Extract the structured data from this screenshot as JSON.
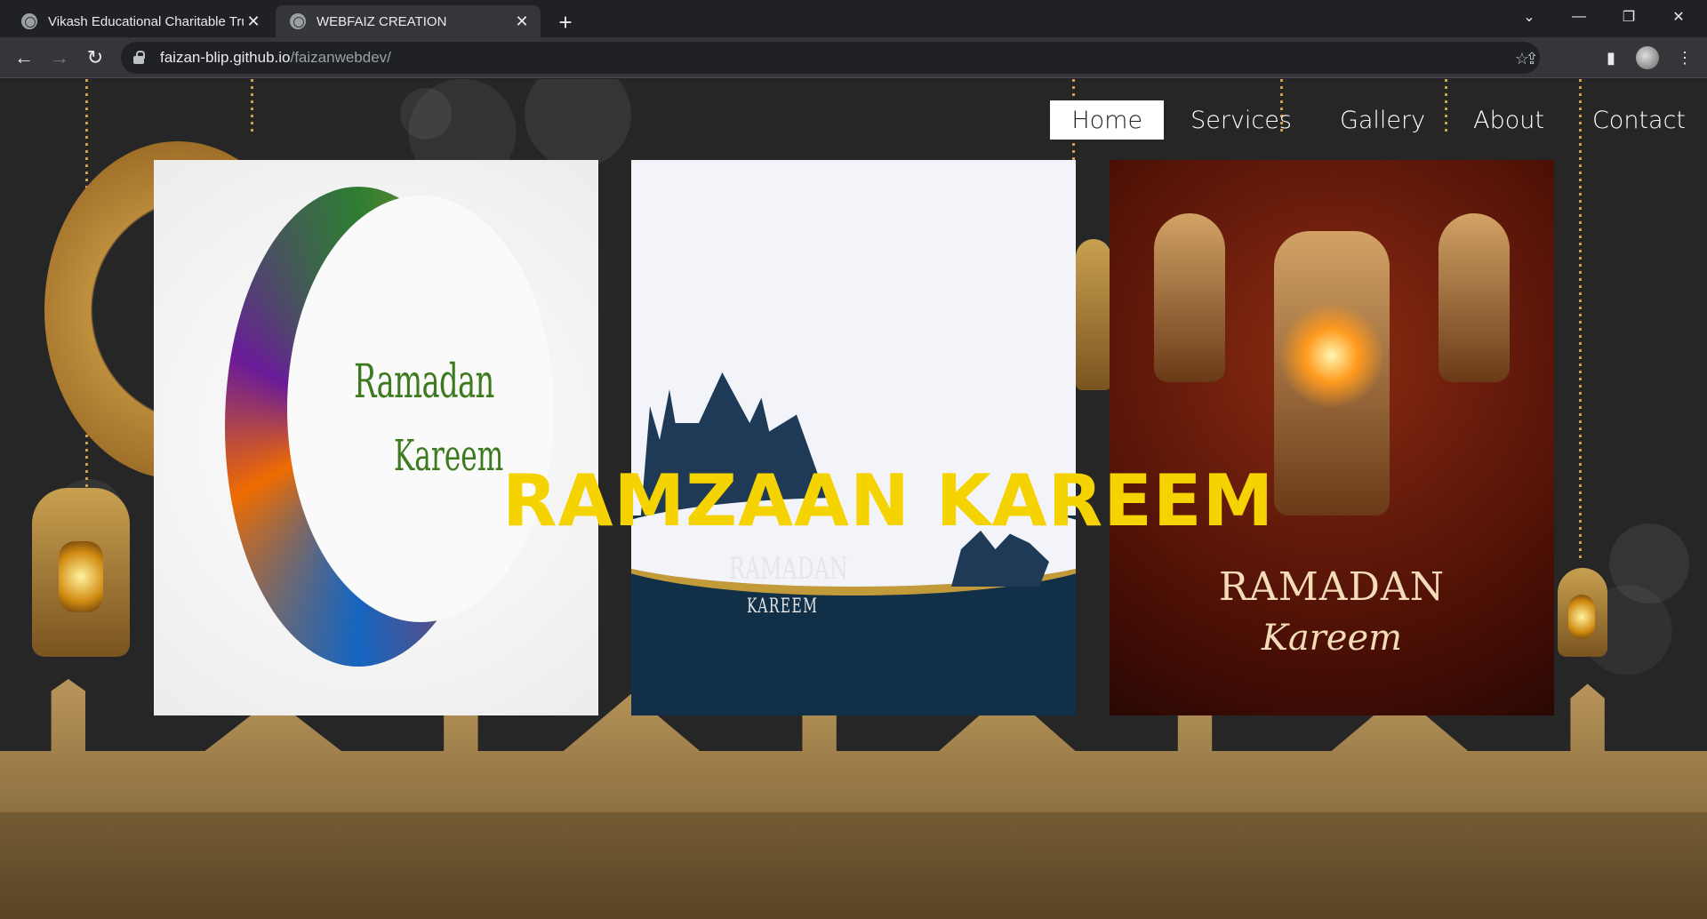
{
  "browser": {
    "tabs": [
      {
        "title": "Vikash Educational Charitable Tru",
        "active": false
      },
      {
        "title": "WEBFAIZ CREATION",
        "active": true
      }
    ],
    "url_host": "faizan-blip.github.io",
    "url_path": "/faizanwebdev/"
  },
  "nav": {
    "items": [
      "Home",
      "Services",
      "Gallery",
      "About",
      "Contact"
    ],
    "active": "Home"
  },
  "headline": "RAMZAAN KAREEM",
  "cards": [
    {
      "line1": "Ramadan",
      "line2": "Kareem"
    },
    {
      "line1": "RAMADAN",
      "line2": "KAREEM"
    },
    {
      "line1": "RAMADAN",
      "line2": "Kareem"
    }
  ],
  "colors": {
    "headline": "#f5d300",
    "page_bg": "#262626",
    "gold": "#c9a24a"
  }
}
